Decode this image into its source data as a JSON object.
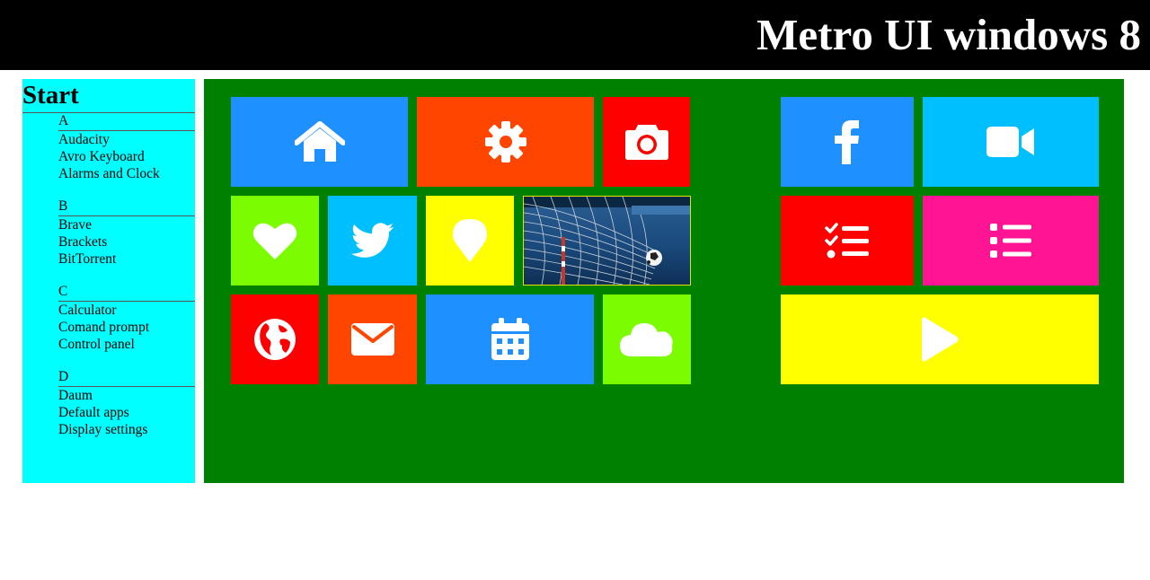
{
  "header": {
    "title": "Metro UI windows 8"
  },
  "sidebar": {
    "title": "Start",
    "groups": [
      {
        "letter": "A",
        "items": [
          "Audacity",
          "Avro Keyboard",
          "Alarms and Clock"
        ]
      },
      {
        "letter": "B",
        "items": [
          "Brave",
          "Brackets",
          "BitTorrent"
        ]
      },
      {
        "letter": "C",
        "items": [
          "Calculator",
          "Comand prompt",
          "Control panel"
        ]
      },
      {
        "letter": "D",
        "items": [
          "Daum",
          "Default apps",
          "Display settings"
        ]
      }
    ]
  },
  "tiles": [
    {
      "icon": "home-icon",
      "color": "#1e90ff"
    },
    {
      "icon": "gear-icon",
      "color": "#ff4500"
    },
    {
      "icon": "camera-icon",
      "color": "#ff0000"
    },
    {
      "icon": "facebook-icon",
      "color": "#1e90ff"
    },
    {
      "icon": "video-camera-icon",
      "color": "#00bfff"
    },
    {
      "icon": "heart-icon",
      "color": "#7cfc00"
    },
    {
      "icon": "twitter-icon",
      "color": "#00bfff"
    },
    {
      "icon": "map-pin-icon",
      "color": "#ffff00"
    },
    {
      "icon": "soccer-goal-photo",
      "color": "#1b3f6b"
    },
    {
      "icon": "checklist-icon",
      "color": "#ff0000"
    },
    {
      "icon": "list-icon",
      "color": "#ff1493"
    },
    {
      "icon": "globe-icon",
      "color": "#ff0000"
    },
    {
      "icon": "envelope-icon",
      "color": "#ff4500"
    },
    {
      "icon": "calendar-icon",
      "color": "#1e90ff"
    },
    {
      "icon": "cloud-icon",
      "color": "#7cfc00"
    },
    {
      "icon": "play-icon",
      "color": "#ffff00"
    }
  ]
}
